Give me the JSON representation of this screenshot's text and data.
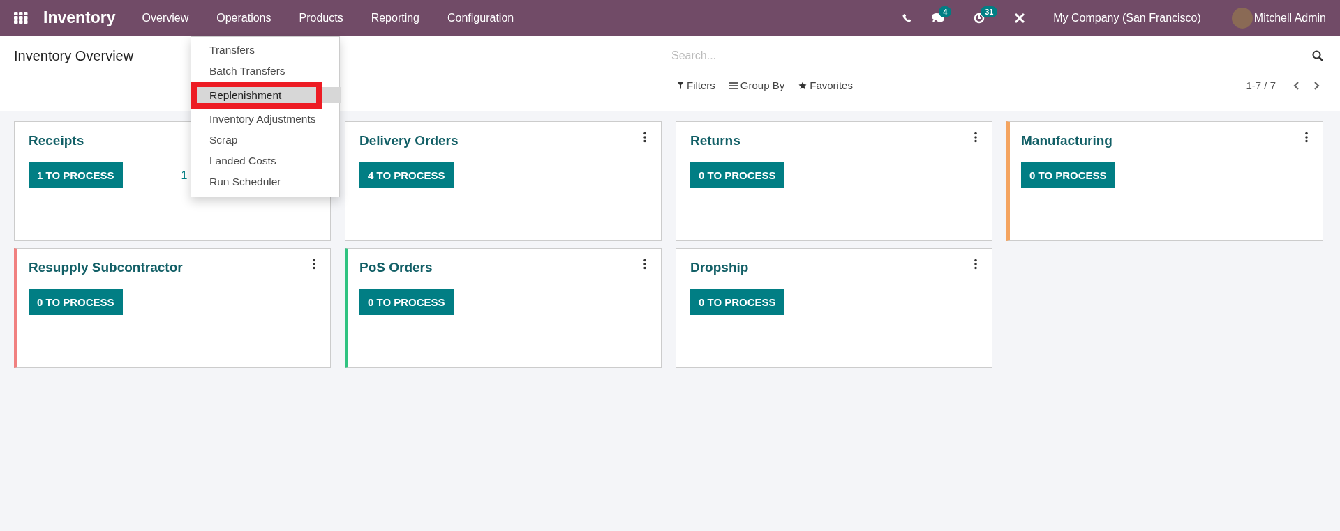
{
  "navbar": {
    "app_name": "Inventory",
    "menu": [
      "Overview",
      "Operations",
      "Products",
      "Reporting",
      "Configuration"
    ],
    "messages_badge": "4",
    "activities_badge": "31",
    "company": "My Company (San Francisco)",
    "user": "Mitchell Admin"
  },
  "operations_menu": [
    {
      "label": "Transfers",
      "selected": false,
      "annotated": false
    },
    {
      "label": "Batch Transfers",
      "selected": false,
      "annotated": false
    },
    {
      "label": "Replenishment",
      "selected": true,
      "annotated": true
    },
    {
      "label": "Inventory Adjustments",
      "selected": false,
      "annotated": false
    },
    {
      "label": "Scrap",
      "selected": false,
      "annotated": false
    },
    {
      "label": "Landed Costs",
      "selected": false,
      "annotated": false
    },
    {
      "label": "Run Scheduler",
      "selected": false,
      "annotated": false
    }
  ],
  "control_panel": {
    "title": "Inventory Overview",
    "search": {
      "placeholder": "Search..."
    },
    "filters": "Filters",
    "group_by": "Group By",
    "favorites": "Favorites",
    "pager": "1-7 / 7"
  },
  "cards": [
    {
      "title": "Receipts",
      "button": "1 TO PROCESS",
      "side_text": "1",
      "menu_icon": false
    },
    {
      "title": "Delivery Orders",
      "button": "4 TO PROCESS",
      "menu_icon": true
    },
    {
      "title": "Returns",
      "button": "0 TO PROCESS",
      "menu_icon": true
    },
    {
      "title": "Manufacturing",
      "button": "0 TO PROCESS",
      "menu_icon": true,
      "color": "#f4a460"
    },
    {
      "title": "Resupply Subcontractor",
      "button": "0 TO PROCESS",
      "menu_icon": true,
      "color": "#f08080"
    },
    {
      "title": "PoS Orders",
      "button": "0 TO PROCESS",
      "menu_icon": true,
      "color": "#30c381"
    },
    {
      "title": "Dropship",
      "button": "0 TO PROCESS",
      "menu_icon": true
    }
  ]
}
